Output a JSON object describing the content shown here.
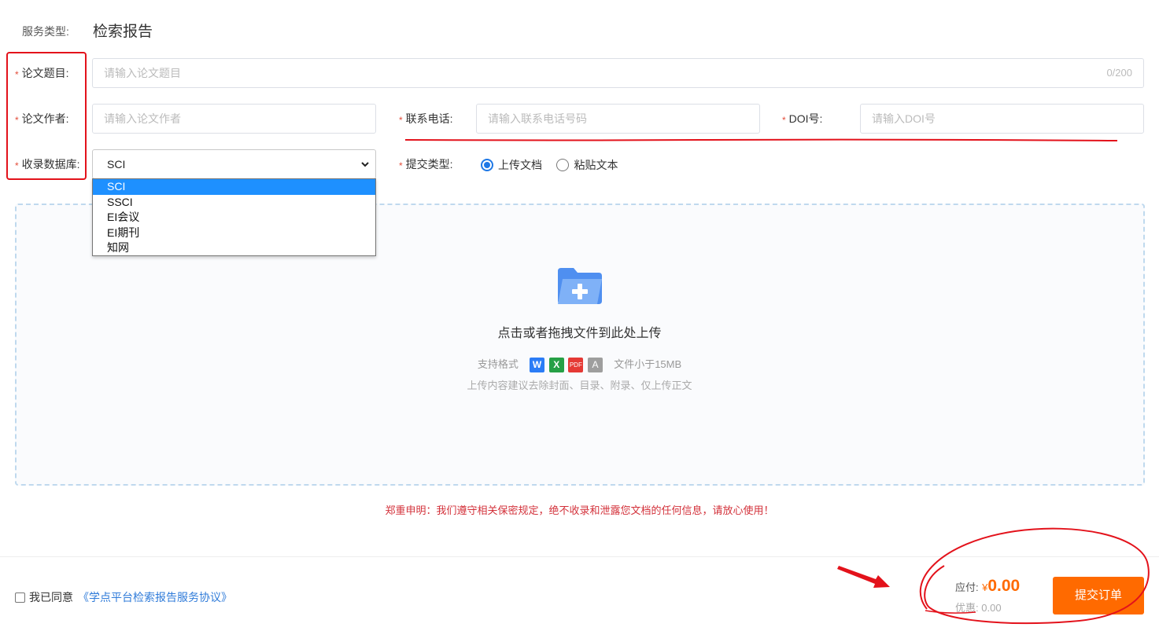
{
  "service": {
    "label": "服务类型:",
    "value": "检索报告"
  },
  "fields": {
    "title": {
      "label": "论文题目:",
      "placeholder": "请输入论文题目",
      "counter": "0/200"
    },
    "author": {
      "label": "论文作者:",
      "placeholder": "请输入论文作者"
    },
    "phone": {
      "label": "联系电话:",
      "placeholder": "请输入联系电话号码"
    },
    "doi": {
      "label": "DOI号:",
      "placeholder": "请输入DOI号"
    },
    "database": {
      "label": "收录数据库:",
      "selected": "SCI",
      "options": [
        "SCI",
        "SSCI",
        "EI会议",
        "EI期刊",
        "知网"
      ]
    },
    "submit_type": {
      "label": "提交类型:",
      "options": [
        "上传文档",
        "粘贴文本"
      ],
      "selected_index": 0
    }
  },
  "upload": {
    "title": "点击或者拖拽文件到此处上传",
    "formats_label": "支持格式",
    "formats": [
      {
        "name": "W",
        "color": "#2b7cf6"
      },
      {
        "name": "X",
        "color": "#26a046"
      },
      {
        "name": "PDF",
        "color": "#e53935"
      },
      {
        "name": "A",
        "color": "#9e9e9e"
      }
    ],
    "size_limit": "文件小于15MB",
    "hint": "上传内容建议去除封面、目录、附录、仅上传正文"
  },
  "notice": "郑重申明：我们遵守相关保密规定，绝不收录和泄露您文档的任何信息，请放心使用！",
  "footer": {
    "agree_prefix": "我已同意",
    "agreement_link": "《学点平台检索报告服务协议》",
    "payable_label": "应付:",
    "currency": "¥",
    "payable_amount": "0.00",
    "discount_label": "优惠:",
    "discount_amount": "0.00",
    "submit_label": "提交订单"
  },
  "colors": {
    "required": "#e34d3a",
    "accent_orange": "#ff6a00",
    "link_blue": "#2f7bd9",
    "annotation_red": "#e3121b",
    "notice_red": "#d3313a"
  }
}
